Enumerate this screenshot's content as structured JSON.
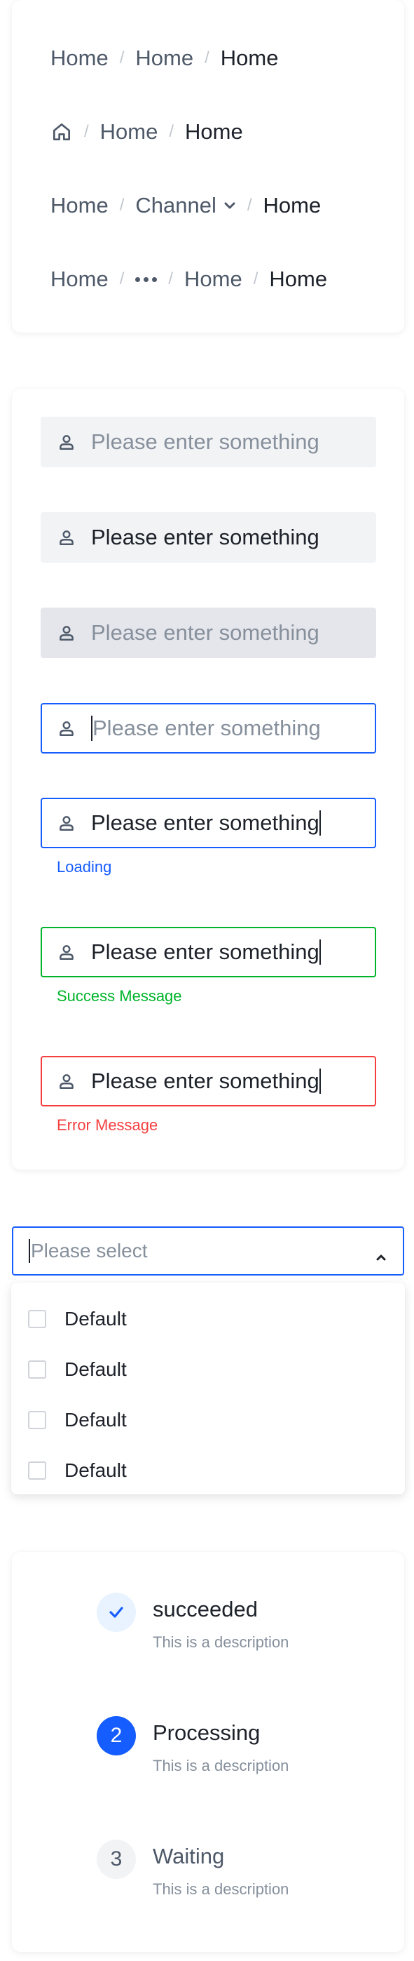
{
  "breadcrumbs": {
    "row1": [
      "Home",
      "Home",
      "Home"
    ],
    "row2": {
      "home_icon": "home-icon",
      "items": [
        "Home",
        "Home"
      ]
    },
    "row3": [
      "Home",
      "Channel",
      "Home"
    ],
    "row4": [
      "Home",
      "Home",
      "Home"
    ],
    "separator": "/"
  },
  "inputs": {
    "placeholder": "Please enter something",
    "value": "Please enter something",
    "icon": "user-icon",
    "loading_message": "Loading",
    "success_message": "Success Message",
    "error_message": "Error Message"
  },
  "select": {
    "placeholder": "Please select",
    "options": [
      "Default",
      "Default",
      "Default",
      "Default"
    ]
  },
  "steps": [
    {
      "number": "1",
      "title": "succeeded",
      "description": "This is a description",
      "status": "done"
    },
    {
      "number": "2",
      "title": "Processing",
      "description": "This is a description",
      "status": "active"
    },
    {
      "number": "3",
      "title": "Waiting",
      "description": "This is a description",
      "status": "wait"
    }
  ],
  "colors": {
    "primary": "#165dff",
    "success": "#00b42a",
    "error": "#f53f3f"
  }
}
